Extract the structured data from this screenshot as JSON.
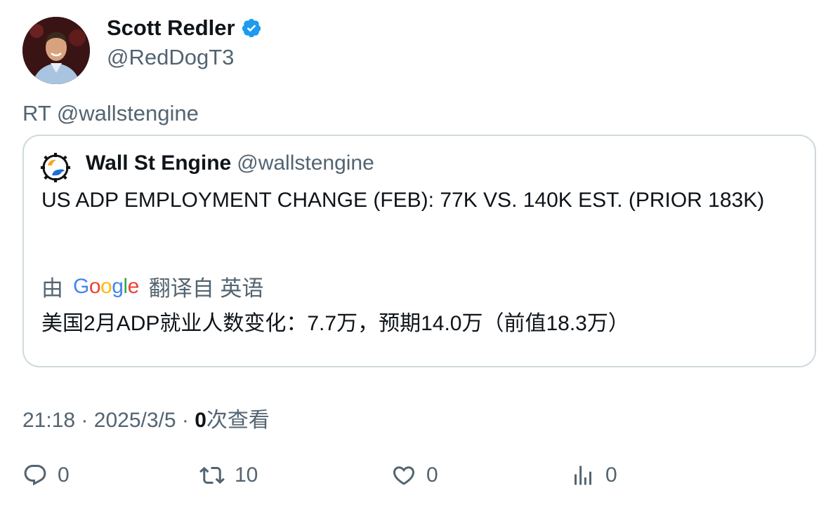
{
  "author": {
    "name": "Scott Redler",
    "handle": "@RedDogT3",
    "verified_color": "#1d9bf0"
  },
  "retweet_line": "RT @wallstengine",
  "quote": {
    "name": "Wall St Engine",
    "handle": "@wallstengine",
    "text": "US ADP EMPLOYMENT CHANGE (FEB): 77K VS. 140K EST. (PRIOR 183K)",
    "translate_prefix": "由",
    "translate_brand": [
      "G",
      "o",
      "o",
      "g",
      "l",
      "e"
    ],
    "translate_suffix": "翻译自 英语",
    "translated_text": "美国2月ADP就业人数变化：7.7万，预期14.0万（前值18.3万）"
  },
  "meta": {
    "time": "21:18",
    "separator": "·",
    "date": "2025/3/5",
    "views_count": "0",
    "views_label": "次查看"
  },
  "actions": {
    "reply": {
      "icon": "reply-icon",
      "count": "0"
    },
    "retweet": {
      "icon": "retweet-icon",
      "count": "10"
    },
    "like": {
      "icon": "heart-icon",
      "count": "0"
    },
    "views": {
      "icon": "analytics-icon",
      "count": "0"
    }
  },
  "colors": {
    "text_primary": "#0f1419",
    "text_secondary": "#536471",
    "border": "#cfd9de",
    "accent": "#1d9bf0"
  }
}
